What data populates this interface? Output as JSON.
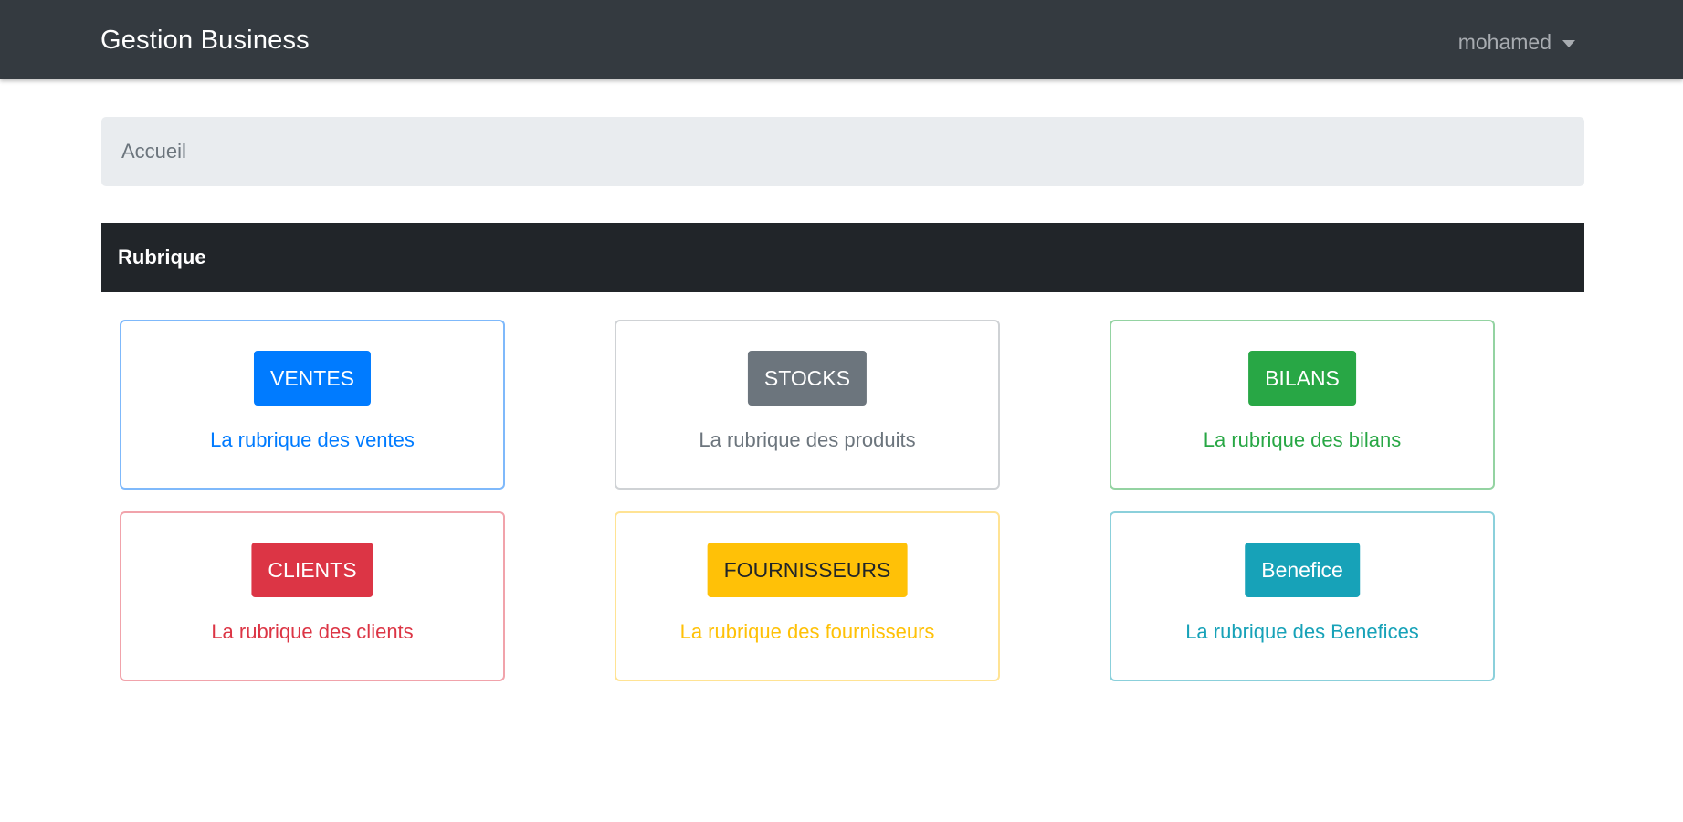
{
  "navbar": {
    "brand": "Gestion Business",
    "user": "mohamed",
    "background": "#343a40"
  },
  "breadcrumb": {
    "items": [
      "Accueil"
    ]
  },
  "section": {
    "title": "Rubrique"
  },
  "cards": [
    {
      "button": "VENTES",
      "text": "La rubrique des ventes",
      "color": "#007bff",
      "border": "#7fb9fb",
      "button_text_color": "#ffffff"
    },
    {
      "button": "STOCKS",
      "text": "La rubrique des produits",
      "color": "#6c757d",
      "border": "#cfd2d5",
      "button_text_color": "#ffffff"
    },
    {
      "button": "BILANS",
      "text": "La rubrique des bilans",
      "color": "#28a745",
      "border": "#94d3a2",
      "button_text_color": "#ffffff"
    },
    {
      "button": "CLIENTS",
      "text": "La rubrique des clients",
      "color": "#dc3545",
      "border": "#f1a3ab",
      "button_text_color": "#ffffff"
    },
    {
      "button": "FOURNISSEURS",
      "text": "La rubrique des fournisseurs",
      "color": "#ffc107",
      "border": "#ffe394",
      "button_text_color": "#212529"
    },
    {
      "button": "Benefice",
      "text": "La rubrique des Benefices",
      "color": "#17a2b8",
      "border": "#8bd0db",
      "button_text_color": "#ffffff"
    }
  ]
}
